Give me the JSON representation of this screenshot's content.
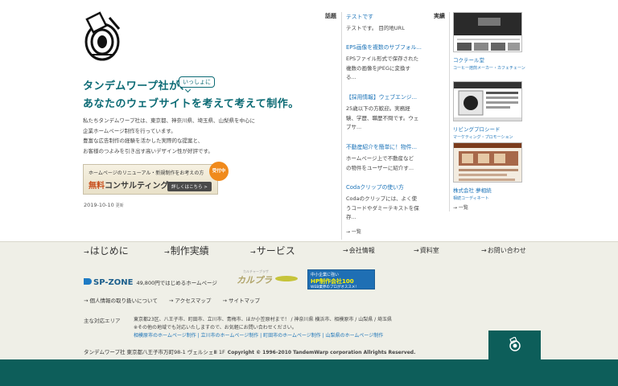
{
  "headline": {
    "line1": "タンデムワープ社が、",
    "bubble": "いっしょに",
    "line2": "あなたのウェブサイトを考えて考えて制作。"
  },
  "intro": [
    "私たちタンデムワープ社は、東京都、神奈川県、埼玉県、山梨県を中心に",
    "企業ホームページ制作を行っています。",
    "豊富な広告制作の経験を活かした実際的な提案と、",
    "お客様のつよみを引き出す高いデザイン性が好評です。"
  ],
  "consult": {
    "sub": "ホームページのリニューアル・新規制作をお考えの方",
    "free": "無料",
    "main": "コンサルティング",
    "detail": "詳しくはこちら >",
    "badge": "受付中"
  },
  "date": {
    "value": "2019-10-10",
    "label": "更新"
  },
  "topics": {
    "label": "話題",
    "items": [
      {
        "title": "テストです",
        "body": [
          "テストです。 目的地URL"
        ]
      },
      {
        "title": "EPS画像を複数のサブフォル...",
        "body": [
          "EPSファイル形式で保存された",
          "複数の画像をJPEGに変換す",
          "る..."
        ]
      },
      {
        "title": "【採用情報】ウェブエンジ...",
        "body": [
          "25歳以下の方歓迎。実務経",
          "験、学歴、職歴不問です。ウェ",
          "ブサ..."
        ]
      },
      {
        "title": "不動産紹介を簡単に！物件...",
        "body": [
          "ホームページ上で不動産など",
          "の物件をユーザーに紹介す..."
        ]
      },
      {
        "title": "Codaクリップの使い方",
        "body": [
          "Codaのクリップには、よく使",
          "うコードやダミーテキストを保",
          "存..."
        ]
      }
    ],
    "more": "→ 一覧"
  },
  "works": {
    "label": "実績",
    "items": [
      {
        "name": "コクテール堂",
        "sub": "コーヒー焙煎メーカー・カフェチェーン"
      },
      {
        "name": "リビングプロシード",
        "sub": "マーケティング・プロモーション"
      },
      {
        "name": "株式会社 夢相続",
        "sub": "相続コーディネート"
      }
    ],
    "more": "→ 一覧"
  },
  "nav": [
    {
      "label": "はじめに",
      "size": "big"
    },
    {
      "label": "制作実績",
      "size": "big"
    },
    {
      "label": "サービス",
      "size": "big"
    },
    {
      "label": "会社情報",
      "size": "small"
    },
    {
      "label": "資料室",
      "size": "small"
    },
    {
      "label": "お問い合わせ",
      "size": "small"
    }
  ],
  "banners": {
    "spzone": {
      "logo": "SP-ZONE",
      "text": "49,800円ではじめるホームページ"
    },
    "kaltra": {
      "name": "カルプラ",
      "sub": "カルチャープラザ"
    },
    "hp": {
      "a": "中小企業に強い",
      "b": "HP制作会社100",
      "c": "WEB業界のプロがオススメ!"
    }
  },
  "links": [
    "→ 個人情報の取り扱いについて",
    "→ アクセスマップ",
    "→ サイトマップ"
  ],
  "area": {
    "label": "主な対応エリア",
    "line1": "東京都23区、八王子市、町田市、立川市、青梅市、ほか小笠原村まで！ / 神奈川県 横浜市、相模原市 / 山梨県 / 埼玉県",
    "line2": "※その他の地域でも対応いたしますので、お気軽にお問い合わせください。",
    "line3": "相模原市のホームページ制作 | 立川市のホームページ制作 | 町田市のホームページ制作 | 山梨県のホームページ制作"
  },
  "address": {
    "text": "タンデムワープ社 東京都八王子市万町98-1 ヴェルシェⅢ 1F",
    "copyright": "Copyright © 1996-2010 TandemWarp corporation Allrights Reserved."
  }
}
